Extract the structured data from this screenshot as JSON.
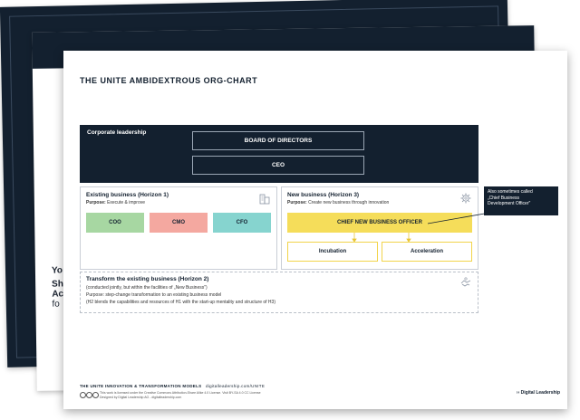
{
  "back_sheet": {},
  "middle_sheet": {
    "lines": [
      "Yo",
      "Sh",
      "Ac",
      "fo"
    ]
  },
  "front_sheet": {
    "title": "THE UNITE AMBIDEXTROUS ORG-CHART",
    "corporate": {
      "label": "Corporate leadership",
      "board": "BOARD OF DIRECTORS",
      "ceo": "CEO"
    },
    "existing": {
      "title": "Existing business (Horizon 1)",
      "purpose_label": "Purpose:",
      "purpose_text": "Execute & improve",
      "roles": [
        {
          "label": "COO",
          "color": "#a7d7a2"
        },
        {
          "label": "CMO",
          "color": "#f4a8a0"
        },
        {
          "label": "CFO",
          "color": "#86d4cf"
        }
      ]
    },
    "new_business": {
      "title": "New business (Horizon 3)",
      "purpose_label": "Purpose:",
      "purpose_text": "Create new business through innovation",
      "cnbo": "CHIEF NEW BUSINESS OFFICER",
      "incubation": "Incubation",
      "acceleration": "Acceleration",
      "accent": "#f5dd5a"
    },
    "callout": {
      "line1": "Also sometimes called",
      "line2": "„Chief Business",
      "line3": "Development Officer\""
    },
    "transform": {
      "title": "Transform the existing business (Horizon 2)",
      "line1": "(conducted jointly, but within the facilities of „New Business\")",
      "line2": "Purpose: step-change transformation  to an existing business model",
      "line3": "(H2 blends the capabilities and resources of H1 with the start-up mentality and structure of H3)"
    },
    "footer": {
      "title": "THE UNITE INNOVATION & TRANSFORMATION MODELS",
      "title_suffix": "digitalleadership.com/UNITE",
      "line1": "This work is licensed under the Creative Commons Attribution-Share Alike 4.0 License. Visit BY-SA 4.0 CC License",
      "line2": "Designed by Digital Leadership AG - digitalleadership.com",
      "brand": "Digital Leadership"
    }
  }
}
